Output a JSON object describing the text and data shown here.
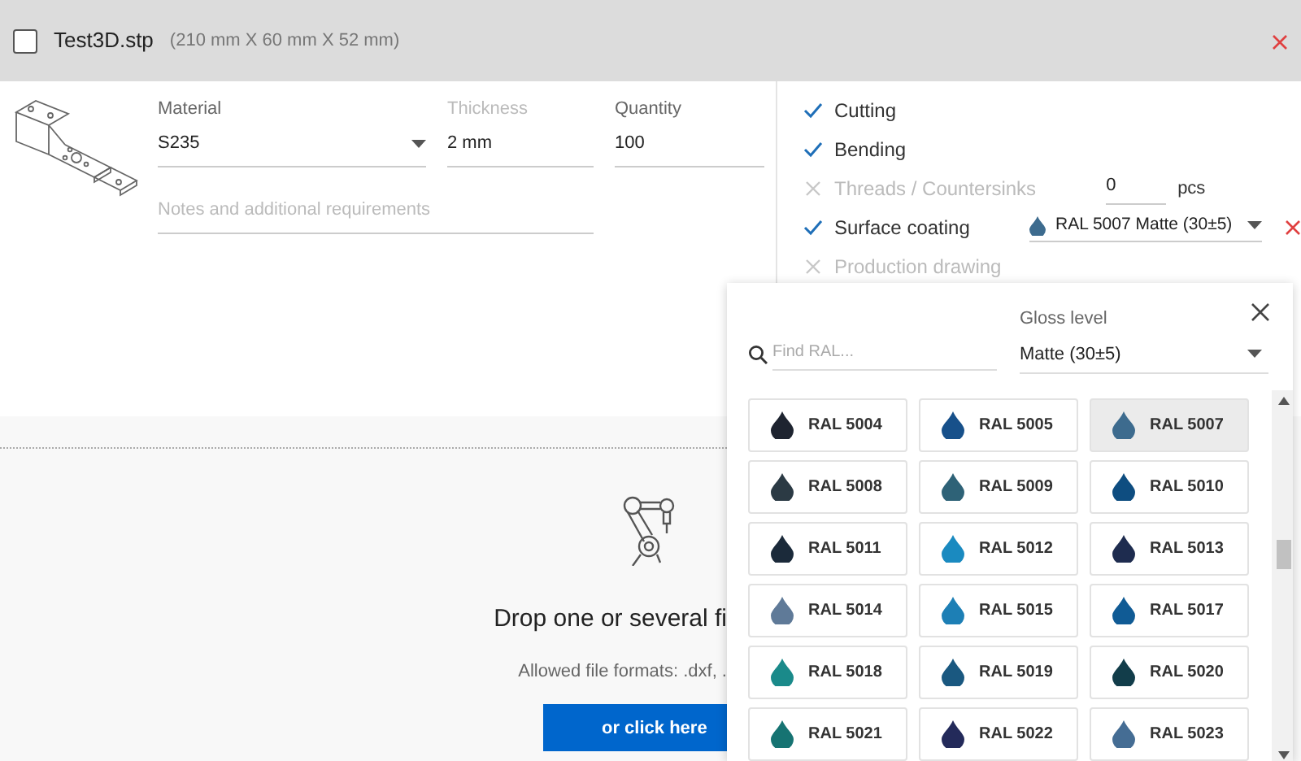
{
  "file_header": {
    "checked": false,
    "file_name": "Test3D.stp",
    "dimensions": "(210 mm X 60 mm X 52 mm)"
  },
  "part_form": {
    "material": {
      "label": "Material",
      "value": "S235"
    },
    "thickness": {
      "label": "Thickness",
      "value": "2 mm",
      "disabled": true
    },
    "quantity": {
      "label": "Quantity",
      "value": "100"
    },
    "notes": {
      "placeholder": "Notes and additional requirements"
    }
  },
  "services": [
    {
      "label": "Cutting",
      "checked": true,
      "kind": "plain"
    },
    {
      "label": "Bending",
      "checked": true,
      "kind": "plain"
    },
    {
      "label": "Threads / Countersinks",
      "checked": false,
      "kind": "count",
      "value": "0",
      "unit": "pcs"
    },
    {
      "label": "Surface coating",
      "checked": true,
      "kind": "coating",
      "value": "RAL 5007 Matte (30±5)",
      "color": "#3d6b8e"
    },
    {
      "label": "Production drawing",
      "checked": false,
      "kind": "plain"
    }
  ],
  "drop_zone": {
    "heading": "Drop one or several fi",
    "formats": "Allowed file formats: .dxf, .",
    "button": "or click here"
  },
  "color_picker": {
    "search": {
      "placeholder": "Find RAL..."
    },
    "gloss": {
      "label": "Gloss level",
      "value": "Matte (30±5)"
    },
    "swatches": [
      {
        "label": "RAL 5004",
        "color": "#1e2430",
        "selected": false
      },
      {
        "label": "RAL 5005",
        "color": "#17508a",
        "selected": false
      },
      {
        "label": "RAL 5007",
        "color": "#3d6b8e",
        "selected": true
      },
      {
        "label": "RAL 5008",
        "color": "#2b3a44",
        "selected": false
      },
      {
        "label": "RAL 5009",
        "color": "#2e6277",
        "selected": false
      },
      {
        "label": "RAL 5010",
        "color": "#0e4d80",
        "selected": false
      },
      {
        "label": "RAL 5011",
        "color": "#1b2a3a",
        "selected": false
      },
      {
        "label": "RAL 5012",
        "color": "#1a8ac0",
        "selected": false
      },
      {
        "label": "RAL 5013",
        "color": "#1e2c4f",
        "selected": false
      },
      {
        "label": "RAL 5014",
        "color": "#5f7a98",
        "selected": false
      },
      {
        "label": "RAL 5015",
        "color": "#1d7fb5",
        "selected": false
      },
      {
        "label": "RAL 5017",
        "color": "#105b95",
        "selected": false
      },
      {
        "label": "RAL 5018",
        "color": "#1a8a8a",
        "selected": false
      },
      {
        "label": "RAL 5019",
        "color": "#1a5880",
        "selected": false
      },
      {
        "label": "RAL 5020",
        "color": "#123d4a",
        "selected": false
      },
      {
        "label": "RAL 5021",
        "color": "#167372",
        "selected": false
      },
      {
        "label": "RAL 5022",
        "color": "#232a5a",
        "selected": false
      },
      {
        "label": "RAL 5023",
        "color": "#456d94",
        "selected": false
      }
    ]
  }
}
